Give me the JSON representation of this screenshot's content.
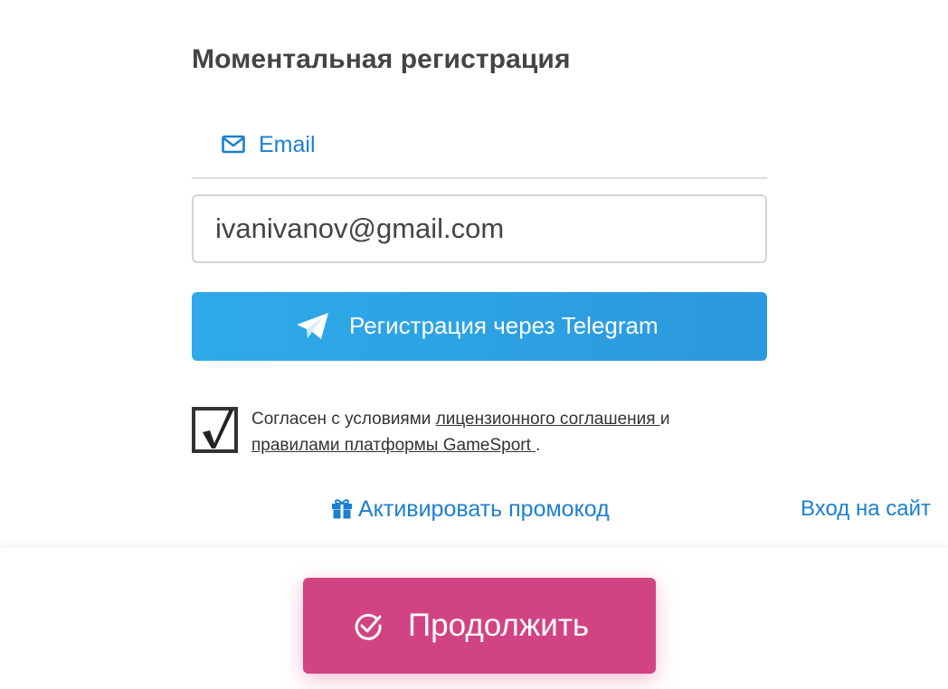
{
  "header": {
    "title": "Моментальная регистрация"
  },
  "tabs": {
    "email": {
      "label": "Email",
      "icon": "envelope-icon"
    }
  },
  "email_field": {
    "value": "ivanivanov@gmail.com"
  },
  "telegram": {
    "label": "Регистрация через Telegram",
    "icon": "telegram-plane-icon"
  },
  "agreement": {
    "checked": true,
    "prefix": "Согласен с условиями ",
    "license_link": "лицензионного соглашения ",
    "middle": "и",
    "rules_link": "правилами платформы GameSport ",
    "suffix": "."
  },
  "links": {
    "promo": "Активировать промокод",
    "promo_icon": "gift-icon",
    "login": "Вход на сайт"
  },
  "continue": {
    "label": "Продолжить",
    "icon": "check-circle-icon"
  },
  "colors": {
    "accent_blue": "#1c7fd3",
    "telegram_blue": "#2eaae9",
    "continue_pink": "#d24383",
    "title_gray": "#444444"
  }
}
